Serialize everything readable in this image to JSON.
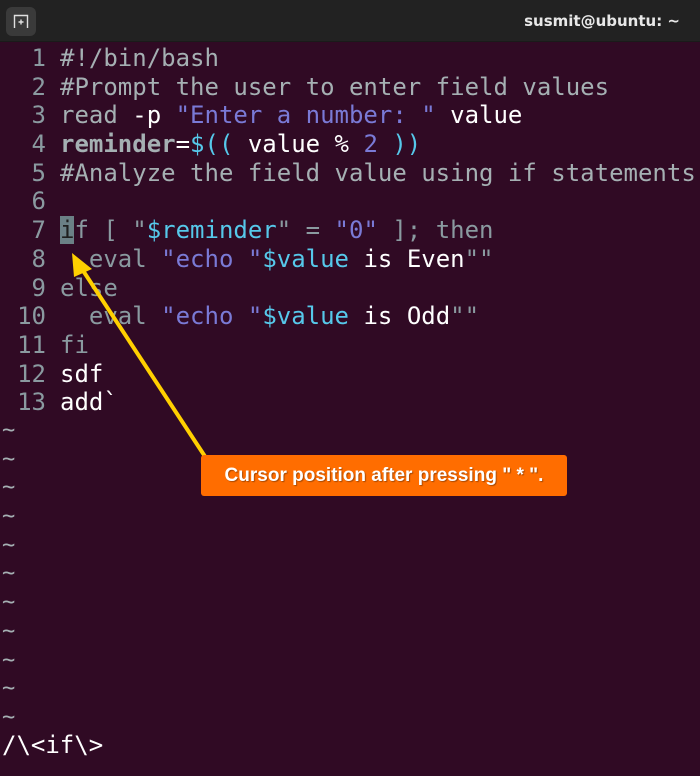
{
  "window": {
    "title": "susmit@ubuntu: ~",
    "new_tab_icon": "new-tab-icon"
  },
  "editor": {
    "lines": [
      {
        "number": "1",
        "tokens": [
          {
            "text": "#!/bin/bash",
            "kind": "comment"
          }
        ]
      },
      {
        "number": "2",
        "tokens": [
          {
            "text": "#Prompt the user to enter field values",
            "kind": "comment"
          }
        ]
      },
      {
        "number": "3",
        "tokens": [
          {
            "text": "read",
            "kind": "stmt"
          },
          {
            "text": " -p ",
            "kind": "plain"
          },
          {
            "text": "\"Enter a number: \"",
            "kind": "string"
          },
          {
            "text": " value",
            "kind": "plain"
          }
        ]
      },
      {
        "number": "4",
        "tokens": [
          {
            "text": "reminder",
            "kind": "bold"
          },
          {
            "text": "=",
            "kind": "plain"
          },
          {
            "text": "$((",
            "kind": "special"
          },
          {
            "text": " value % ",
            "kind": "plain"
          },
          {
            "text": "2",
            "kind": "string"
          },
          {
            "text": " ))",
            "kind": "special"
          }
        ]
      },
      {
        "number": "5",
        "tokens": [
          {
            "text": "#Analyze the field value using if statements",
            "kind": "comment"
          }
        ]
      },
      {
        "number": "6",
        "tokens": []
      },
      {
        "number": "7",
        "tokens": [
          {
            "text": "i",
            "kind": "cursor"
          },
          {
            "text": "f [ ",
            "kind": "dim"
          },
          {
            "text": "\"",
            "kind": "dim"
          },
          {
            "text": "$reminder",
            "kind": "special"
          },
          {
            "text": "\" = ",
            "kind": "dim"
          },
          {
            "text": "\"0\"",
            "kind": "string"
          },
          {
            "text": " ]; then",
            "kind": "dim"
          }
        ]
      },
      {
        "number": "8",
        "tokens": [
          {
            "text": "  eval ",
            "kind": "dim"
          },
          {
            "text": "\"echo \"",
            "kind": "string"
          },
          {
            "text": "$value",
            "kind": "special"
          },
          {
            "text": " is Even",
            "kind": "plain"
          },
          {
            "text": "\"\"",
            "kind": "dim"
          }
        ]
      },
      {
        "number": "9",
        "tokens": [
          {
            "text": "else",
            "kind": "dim"
          }
        ]
      },
      {
        "number": "10",
        "tokens": [
          {
            "text": "  eval ",
            "kind": "dim"
          },
          {
            "text": "\"echo \"",
            "kind": "string"
          },
          {
            "text": "$value",
            "kind": "special"
          },
          {
            "text": " is Odd",
            "kind": "plain"
          },
          {
            "text": "\"\"",
            "kind": "dim"
          }
        ]
      },
      {
        "number": "11",
        "tokens": [
          {
            "text": "fi",
            "kind": "dim"
          }
        ]
      },
      {
        "number": "12",
        "tokens": [
          {
            "text": "sdf",
            "kind": "plain"
          }
        ]
      },
      {
        "number": "13",
        "tokens": [
          {
            "text": "add`",
            "kind": "plain"
          }
        ]
      }
    ],
    "empty_line_marker": "~",
    "empty_line_count": 11,
    "cursor": {
      "line": 7,
      "column": 1,
      "char": "i"
    }
  },
  "command_line": "/\\<if\\>",
  "annotation": {
    "text": "Cursor position after pressing \" * \".",
    "box_color": "#ff6d00",
    "arrow_color": "#ffd000"
  },
  "colors": {
    "background": "#300a24",
    "titlebar": "#222222"
  }
}
